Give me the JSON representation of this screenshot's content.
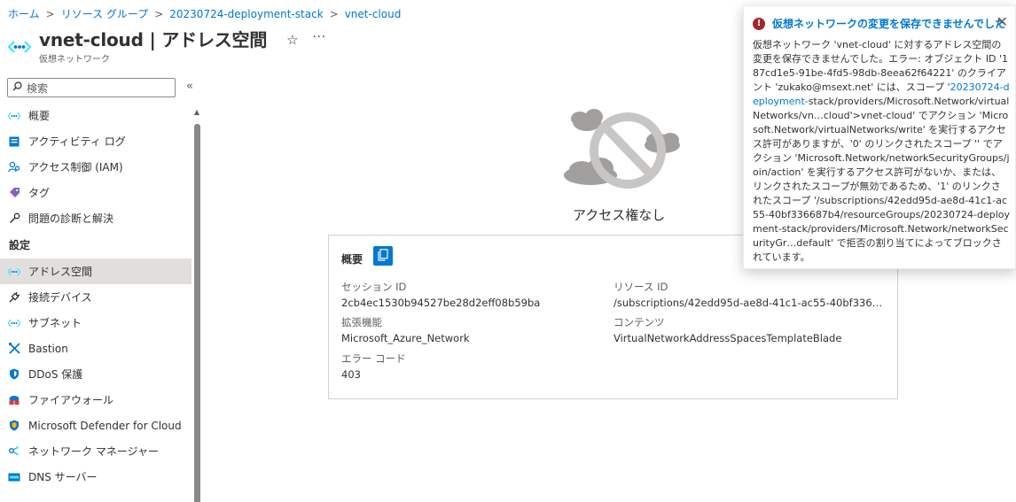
{
  "breadcrumb": {
    "items": [
      "ホーム",
      "リソース グループ",
      "20230724-deployment-stack",
      "vnet-cloud"
    ],
    "sep": ">"
  },
  "header": {
    "title": "vnet-cloud | アドレス空間",
    "subtitle": "仮想ネットワーク",
    "star": "☆",
    "more": "···"
  },
  "search": {
    "placeholder": "検索",
    "collapse": "«"
  },
  "sidebar": {
    "items_top": [
      {
        "label": "概要",
        "icon": "vnet-icon"
      },
      {
        "label": "アクティビティ ログ",
        "icon": "activity-log-icon"
      },
      {
        "label": "アクセス制御 (IAM)",
        "icon": "iam-icon"
      },
      {
        "label": "タグ",
        "icon": "tag-icon"
      },
      {
        "label": "問題の診断と解決",
        "icon": "wrench-icon"
      }
    ],
    "section_settings": "設定",
    "items_settings": [
      {
        "label": "アドレス空間",
        "icon": "vnet-icon",
        "active": true
      },
      {
        "label": "接続デバイス",
        "icon": "plug-icon"
      },
      {
        "label": "サブネット",
        "icon": "vnet-icon"
      },
      {
        "label": "Bastion",
        "icon": "bastion-icon"
      },
      {
        "label": "DDoS 保護",
        "icon": "shield-icon"
      },
      {
        "label": "ファイアウォール",
        "icon": "firewall-icon"
      },
      {
        "label": "Microsoft Defender for Cloud",
        "icon": "defender-icon"
      },
      {
        "label": "ネットワーク マネージャー",
        "icon": "network-manager-icon"
      },
      {
        "label": "DNS サーバー",
        "icon": "dns-icon"
      }
    ]
  },
  "main": {
    "no_access_title": "アクセス権なし",
    "card": {
      "title": "概要",
      "session_label": "セッション ID",
      "session_value": "2cb4ec1530b94527be28d2eff08b59ba",
      "resource_label": "リソース ID",
      "resource_value": "/subscriptions/42edd95d-ae8d-41c1-ac55-40bf336687b…",
      "extension_label": "拡張機能",
      "extension_value": "Microsoft_Azure_Network",
      "content_label": "コンテンツ",
      "content_value": "VirtualNetworkAddressSpacesTemplateBlade",
      "error_label": "エラー コード",
      "error_value": "403"
    }
  },
  "toast": {
    "title": "仮想ネットワークの変更を保存できませんでした",
    "body_1": "仮想ネットワーク 'vnet-cloud' に対するアドレス空間の変更を保存できませんでした。エラー: オブジェクト ID '187cd1e5-91be-4fd5-98db-8eea62f64221' のクライアント 'zukako@msext.net' には、スコープ '",
    "body_link": "20230724-deployment-",
    "body_2": "stack/providers/Microsoft.Network/virtualNetworks/vn…cloud'>vnet-cloud' でアクション 'Microsoft.Network/virtualNetworks/write' を実行するアクセス許可がありますが、'0' のリンクされたスコープ '' でアクション 'Microsoft.Network/networkSecurityGroups/join/action' を実行するアクセス許可がないか、または、リンクされたスコープが無効であるため、'1' のリンクされたスコープ '/subscriptions/42edd95d-ae8d-41c1-ac55-40bf336687b4/resourceGroups/20230724-deployment-stack/providers/Microsoft.Network/networkSecurityGr…default' で拒否の割り当てによってブロックされています。",
    "close": "✕",
    "error_glyph": "!"
  },
  "colors": {
    "accent": "#0078d4",
    "error": "#a4262c",
    "active_bg": "#e1dfdd"
  }
}
